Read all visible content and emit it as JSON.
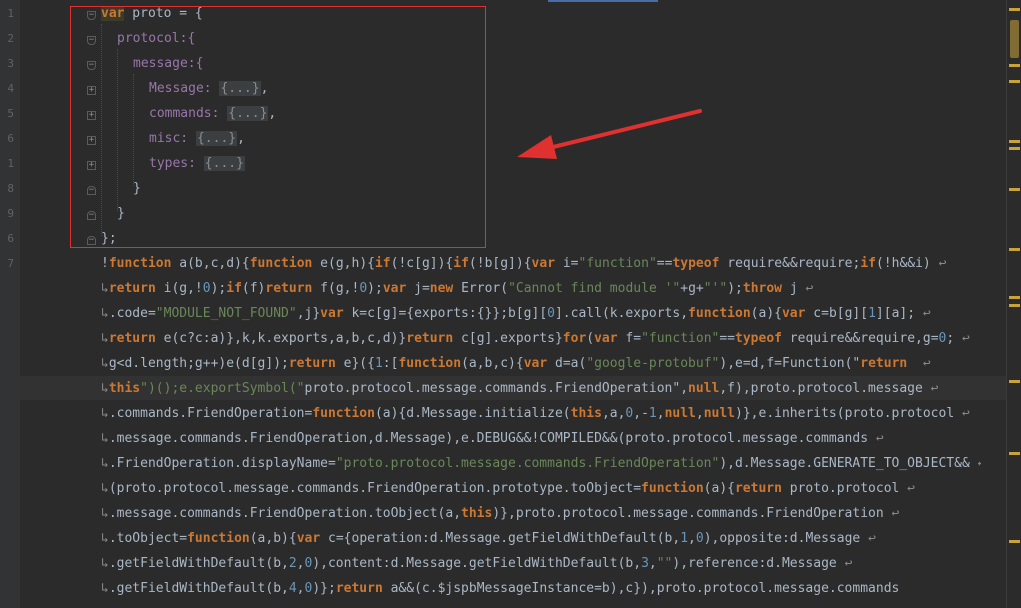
{
  "gutter": {
    "line_numbers": [
      "1",
      "2",
      "3",
      "4",
      "5",
      "6",
      "1",
      "8",
      "9",
      "6",
      "7"
    ]
  },
  "code": {
    "fold_placeholder": "{...}",
    "proto_block": {
      "line1_kw": "var",
      "line1_rest": " proto = {",
      "line2": "protocol:{",
      "line3": "message:{",
      "line4_key": "Message: ",
      "line5_key": "commands: ",
      "line6_key": "misc: ",
      "line7_key": "types: ",
      "comma": ",",
      "close_inner": "}",
      "close_mid": "}",
      "close_outer": "};"
    },
    "minified_lines": [
      "!function a(b,c,d){function e(g,h){if(!c[g]){if(!b[g]){var i=\"function\"==typeof require&&require;if(!h&&i)",
      "return i(g,!0);if(f)return f(g,!0);var j=new Error(\"Cannot find module '\"+g+\"'\");throw j",
      ".code=\"MODULE_NOT_FOUND\",j}var k=c[g]={exports:{}};b[g][0].call(k.exports,function(a){var c=b[g][1][a];",
      "return e(c?c:a)},k,k.exports,a,b,c,d)}return c[g].exports}for(var f=\"function\"==typeof require&&require,g=0;",
      "g<d.length;g++)e(d[g]);return e}({1:[function(a,b,c){var d=a(\"google-protobuf\"),e=d,f=Function(\"return ",
      "this\")();e.exportSymbol(\"proto.protocol.message.commands.FriendOperation\",null,f),proto.protocol.message",
      ".commands.FriendOperation=function(a){d.Message.initialize(this,a,0,-1,null,null)},e.inherits(proto.protocol",
      ".message.commands.FriendOperation,d.Message),e.DEBUG&&!COMPILED&&(proto.protocol.message.commands",
      ".FriendOperation.displayName=\"proto.protocol.message.commands.FriendOperation\"),d.Message.GENERATE_TO_OBJECT&&",
      "(proto.protocol.message.commands.FriendOperation.prototype.toObject=function(a){return proto.protocol",
      ".message.commands.FriendOperation.toObject(a,this)},proto.protocol.message.commands.FriendOperation",
      ".toObject=function(a,b){var c={operation:d.Message.getFieldWithDefault(b,1,0),opposite:d.Message",
      ".getFieldWithDefault(b,2,0),content:d.Message.getFieldWithDefault(b,3,\"\"),reference:d.Message",
      ".getFieldWithDefault(b,4,0)};return a&&(c.$jspbMessageInstance=b),c}),proto.protocol.message.commands"
    ]
  },
  "colors": {
    "background": "#2b2b2b",
    "keyword": "#cc7832",
    "string": "#6a8759",
    "number": "#6897bb",
    "annotation_box": "#e0302f",
    "annotation_arrow": "#e0302f"
  },
  "icons": {
    "wrap": "soft-wrap-icon",
    "fold": "fold-marker-icon"
  }
}
